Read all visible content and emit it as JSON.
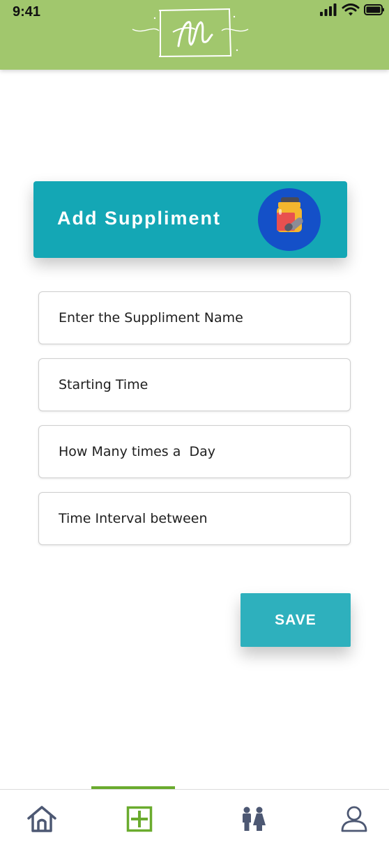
{
  "status_bar": {
    "time": "9:41"
  },
  "header": {
    "logo_icon": "handwritten-logo"
  },
  "title_card": {
    "title": "Add Suppliment",
    "badge_icon": "supplement-jar-icon"
  },
  "form": {
    "fields": [
      {
        "placeholder": "Enter the Suppliment Name",
        "value": ""
      },
      {
        "placeholder": "Starting Time",
        "value": ""
      },
      {
        "placeholder": "How Many times a  Day",
        "value": ""
      },
      {
        "placeholder": "Time Interval between",
        "value": ""
      }
    ],
    "save_label": "SAVE"
  },
  "bottom_nav": {
    "items": [
      {
        "icon": "home-icon",
        "active": false
      },
      {
        "icon": "add-square-icon",
        "active": true
      },
      {
        "icon": "family-icon",
        "active": false
      },
      {
        "icon": "user-icon",
        "active": false
      }
    ]
  },
  "colors": {
    "header_bg": "#a1c76d",
    "title_card_bg": "#14a7b5",
    "badge_bg": "#1450c8",
    "save_bg": "#2eb0bd",
    "nav_active": "#6aab2e",
    "nav_icon": "#4d5873"
  }
}
